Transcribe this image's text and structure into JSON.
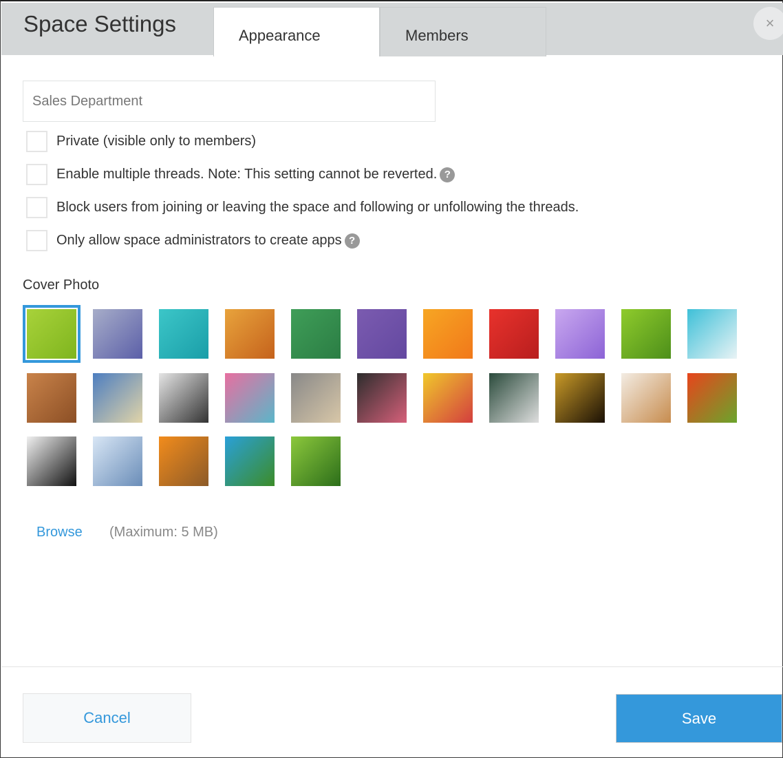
{
  "header": {
    "title": "Space Settings",
    "tabs": [
      {
        "label": "Appearance",
        "active": true
      },
      {
        "label": "Members",
        "active": false
      }
    ],
    "close_icon": "close-icon",
    "close_label": "×"
  },
  "form": {
    "space_name": "Sales Department",
    "checkboxes": [
      {
        "label": "Private (visible only to members)",
        "checked": false,
        "help": false
      },
      {
        "label": "Enable multiple threads. Note: This setting cannot be reverted.",
        "checked": false,
        "help": true
      },
      {
        "label": "Block users from joining or leaving the space and following or unfollowing the threads.",
        "checked": false,
        "help": false
      },
      {
        "label": "Only allow space administrators to create apps",
        "checked": false,
        "help": true
      }
    ],
    "help_glyph": "?"
  },
  "cover": {
    "label": "Cover Photo",
    "selected": 0,
    "thumbnails": [
      [
        "#a8d23a",
        "#7fb51e"
      ],
      [
        "#a7adc9",
        "#5b5fa8"
      ],
      [
        "#3cc6c8",
        "#1a9ea8"
      ],
      [
        "#e8a33c",
        "#c5621c"
      ],
      [
        "#3f9e58",
        "#2b7d44"
      ],
      [
        "#7b5bb0",
        "#6348a0"
      ],
      [
        "#f7a623",
        "#f1781a"
      ],
      [
        "#e8322c",
        "#b81e1e"
      ],
      [
        "#c9a8ef",
        "#8c63d6"
      ],
      [
        "#8fcb2c",
        "#4d8f1a"
      ],
      [
        "#3ec0d8",
        "#e9f3f5"
      ],
      [
        "#c9834a",
        "#8c4f25"
      ],
      [
        "#4d7ec0",
        "#e1d4a8"
      ],
      [
        "#e5e5e5",
        "#333333"
      ],
      [
        "#e86fa0",
        "#5ab6c9"
      ],
      [
        "#888888",
        "#d8c7a8"
      ],
      [
        "#2d2d2d",
        "#d6607a"
      ],
      [
        "#f0c82c",
        "#d33e3e"
      ],
      [
        "#2b4b3c",
        "#dedede"
      ],
      [
        "#c99a28",
        "#1a1005"
      ],
      [
        "#f3ece3",
        "#c78c4e"
      ],
      [
        "#e8441c",
        "#6aa52c"
      ],
      [
        "#f0f0f0",
        "#111111"
      ],
      [
        "#d8e6f5",
        "#6a8db8"
      ],
      [
        "#f28c1c",
        "#8c5a28"
      ],
      [
        "#2aa0d8",
        "#3c8c28"
      ],
      [
        "#8cc83c",
        "#2c6e1a"
      ]
    ],
    "browse_label": "Browse",
    "max_label": "(Maximum: 5 MB)"
  },
  "footer": {
    "cancel_label": "Cancel",
    "save_label": "Save"
  }
}
